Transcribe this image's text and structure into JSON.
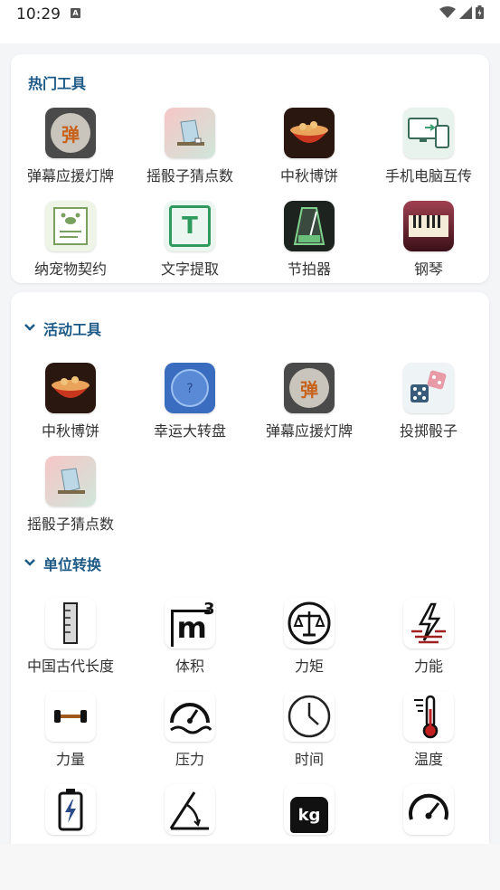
{
  "status": {
    "time": "10:29"
  },
  "hot": {
    "title": "热门工具",
    "items": [
      {
        "label": "弹幕应援灯牌",
        "icon": "danmu-icon"
      },
      {
        "label": "摇骰子猜点数",
        "icon": "dice-cup-icon"
      },
      {
        "label": "中秋博饼",
        "icon": "mooncake-bowl-icon"
      },
      {
        "label": "手机电脑互传",
        "icon": "phone-pc-transfer-icon"
      },
      {
        "label": "纳宠物契约",
        "icon": "pet-contract-icon"
      },
      {
        "label": "文字提取",
        "icon": "text-extract-icon"
      },
      {
        "label": "节拍器",
        "icon": "metronome-icon"
      },
      {
        "label": "钢琴",
        "icon": "piano-icon"
      }
    ]
  },
  "activity": {
    "title": "活动工具",
    "items": [
      {
        "label": "中秋博饼",
        "icon": "mooncake-bowl-icon"
      },
      {
        "label": "幸运大转盘",
        "icon": "lucky-wheel-icon"
      },
      {
        "label": "弹幕应援灯牌",
        "icon": "danmu-icon"
      },
      {
        "label": "投掷骰子",
        "icon": "dice-icon"
      },
      {
        "label": "摇骰子猜点数",
        "icon": "dice-cup-icon"
      }
    ]
  },
  "units": {
    "title": "单位转换",
    "items": [
      {
        "label": "中国古代长度",
        "icon": "ruler-icon"
      },
      {
        "label": "体积",
        "icon": "cubic-meter-icon"
      },
      {
        "label": "力矩",
        "icon": "balance-scale-icon"
      },
      {
        "label": "力能",
        "icon": "energy-icon"
      },
      {
        "label": "力量",
        "icon": "dumbbell-icon"
      },
      {
        "label": "压力",
        "icon": "pressure-gauge-icon"
      },
      {
        "label": "时间",
        "icon": "clock-icon"
      },
      {
        "label": "温度",
        "icon": "thermometer-icon"
      },
      {
        "label": "",
        "icon": "battery-icon"
      },
      {
        "label": "",
        "icon": "angle-icon"
      },
      {
        "label": "",
        "icon": "kg-weight-icon"
      },
      {
        "label": "",
        "icon": "speedometer-icon"
      }
    ]
  },
  "icon_text": {
    "danmu": "弹",
    "text_extract": "T",
    "cubic": "m",
    "cubic_sup": "3",
    "kg": "kg"
  },
  "colors": {
    "accent": "#1d5a86",
    "danmu": "#c8621a"
  }
}
